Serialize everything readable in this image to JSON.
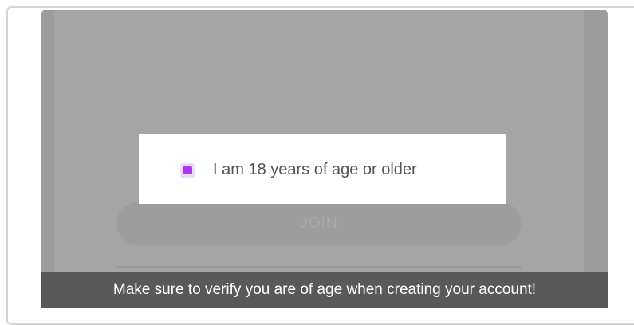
{
  "screen": {
    "age_checkbox": {
      "label": "I am 18 years of age or older",
      "checked": true,
      "accent_color": "#a83bf0"
    },
    "join_button": {
      "label": "JOIN"
    }
  },
  "caption": {
    "text": "Make sure to verify you are of age when creating your account!"
  }
}
